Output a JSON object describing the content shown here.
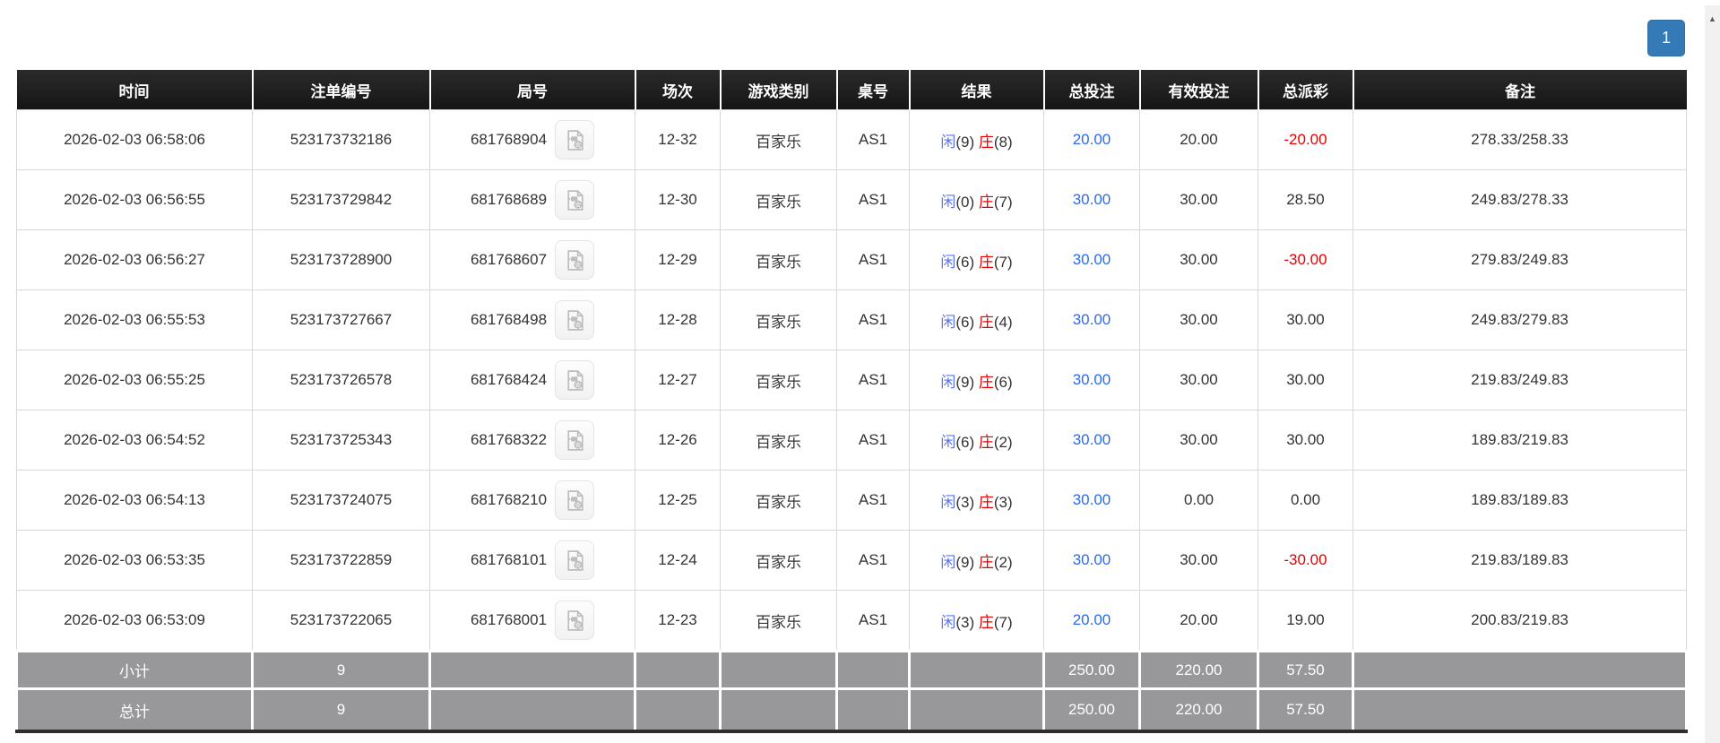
{
  "pagination": {
    "current": "1"
  },
  "colors": {
    "header_bg": "#1d1d1d",
    "accent_blue": "#2a6af0",
    "player_blue": "#5b74f0",
    "loss_red": "#e60000",
    "summary_gray": "#98989a",
    "pager_blue": "#337ab7"
  },
  "icons": {
    "video_replay": "video-file-icon",
    "scroll_up": "▲"
  },
  "table": {
    "headers": [
      "时间",
      "注单编号",
      "局号",
      "场次",
      "游戏类别",
      "桌号",
      "结果",
      "总投注",
      "有效投注",
      "总派彩",
      "备注"
    ],
    "rows": [
      {
        "time": "2026-02-03 06:58:06",
        "bet_id": "523173732186",
        "round_id": "681768904",
        "session": "12-32",
        "game_type": "百家乐",
        "table_no": "AS1",
        "result": {
          "player_label": "闲",
          "player_score": "(9)",
          "banker_label": "庄",
          "banker_score": "(8)"
        },
        "total_bet": "20.00",
        "valid_bet": "20.00",
        "payout": "-20.00",
        "remark": "278.33/258.33"
      },
      {
        "time": "2026-02-03 06:56:55",
        "bet_id": "523173729842",
        "round_id": "681768689",
        "session": "12-30",
        "game_type": "百家乐",
        "table_no": "AS1",
        "result": {
          "player_label": "闲",
          "player_score": "(0)",
          "banker_label": "庄",
          "banker_score": "(7)"
        },
        "total_bet": "30.00",
        "valid_bet": "30.00",
        "payout": "28.50",
        "remark": "249.83/278.33"
      },
      {
        "time": "2026-02-03 06:56:27",
        "bet_id": "523173728900",
        "round_id": "681768607",
        "session": "12-29",
        "game_type": "百家乐",
        "table_no": "AS1",
        "result": {
          "player_label": "闲",
          "player_score": "(6)",
          "banker_label": "庄",
          "banker_score": "(7)"
        },
        "total_bet": "30.00",
        "valid_bet": "30.00",
        "payout": "-30.00",
        "remark": "279.83/249.83"
      },
      {
        "time": "2026-02-03 06:55:53",
        "bet_id": "523173727667",
        "round_id": "681768498",
        "session": "12-28",
        "game_type": "百家乐",
        "table_no": "AS1",
        "result": {
          "player_label": "闲",
          "player_score": "(6)",
          "banker_label": "庄",
          "banker_score": "(4)"
        },
        "total_bet": "30.00",
        "valid_bet": "30.00",
        "payout": "30.00",
        "remark": "249.83/279.83"
      },
      {
        "time": "2026-02-03 06:55:25",
        "bet_id": "523173726578",
        "round_id": "681768424",
        "session": "12-27",
        "game_type": "百家乐",
        "table_no": "AS1",
        "result": {
          "player_label": "闲",
          "player_score": "(9)",
          "banker_label": "庄",
          "banker_score": "(6)"
        },
        "total_bet": "30.00",
        "valid_bet": "30.00",
        "payout": "30.00",
        "remark": "219.83/249.83"
      },
      {
        "time": "2026-02-03 06:54:52",
        "bet_id": "523173725343",
        "round_id": "681768322",
        "session": "12-26",
        "game_type": "百家乐",
        "table_no": "AS1",
        "result": {
          "player_label": "闲",
          "player_score": "(6)",
          "banker_label": "庄",
          "banker_score": "(2)"
        },
        "total_bet": "30.00",
        "valid_bet": "30.00",
        "payout": "30.00",
        "remark": "189.83/219.83"
      },
      {
        "time": "2026-02-03 06:54:13",
        "bet_id": "523173724075",
        "round_id": "681768210",
        "session": "12-25",
        "game_type": "百家乐",
        "table_no": "AS1",
        "result": {
          "player_label": "闲",
          "player_score": "(3)",
          "banker_label": "庄",
          "banker_score": "(3)"
        },
        "total_bet": "30.00",
        "valid_bet": "0.00",
        "payout": "0.00",
        "remark": "189.83/189.83"
      },
      {
        "time": "2026-02-03 06:53:35",
        "bet_id": "523173722859",
        "round_id": "681768101",
        "session": "12-24",
        "game_type": "百家乐",
        "table_no": "AS1",
        "result": {
          "player_label": "闲",
          "player_score": "(9)",
          "banker_label": "庄",
          "banker_score": "(2)"
        },
        "total_bet": "30.00",
        "valid_bet": "30.00",
        "payout": "-30.00",
        "remark": "219.83/189.83"
      },
      {
        "time": "2026-02-03 06:53:09",
        "bet_id": "523173722065",
        "round_id": "681768001",
        "session": "12-23",
        "game_type": "百家乐",
        "table_no": "AS1",
        "result": {
          "player_label": "闲",
          "player_score": "(3)",
          "banker_label": "庄",
          "banker_score": "(7)"
        },
        "total_bet": "20.00",
        "valid_bet": "20.00",
        "payout": "19.00",
        "remark": "200.83/219.83"
      }
    ],
    "summary": {
      "subtotal": {
        "label": "小计",
        "count": "9",
        "total_bet": "250.00",
        "valid_bet": "220.00",
        "payout": "57.50"
      },
      "total": {
        "label": "总计",
        "count": "9",
        "total_bet": "250.00",
        "valid_bet": "220.00",
        "payout": "57.50"
      }
    }
  }
}
